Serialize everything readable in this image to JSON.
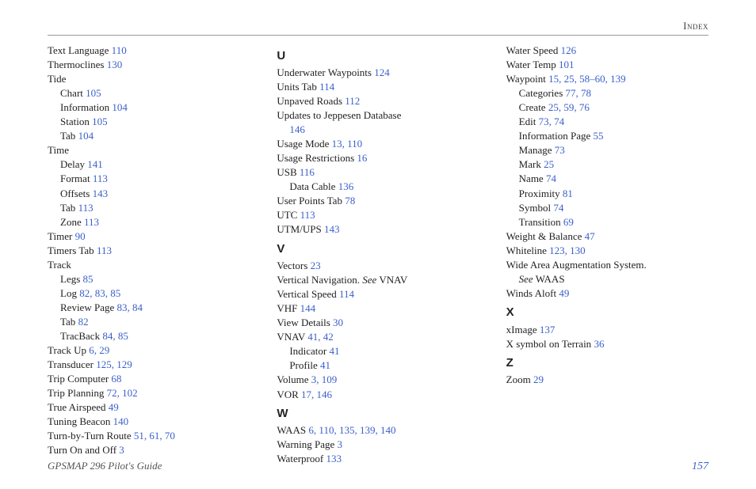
{
  "header": {
    "title": "Index"
  },
  "footer": {
    "guide": "GPSMAP 296 Pilot's Guide",
    "page": "157"
  },
  "columns": [
    {
      "groups": [
        {
          "letter": null,
          "entries": [
            {
              "indent": 0,
              "term": "Text Language",
              "pages": "110"
            },
            {
              "indent": 0,
              "term": "Thermoclines",
              "pages": "130"
            },
            {
              "indent": 0,
              "term": "Tide",
              "pages": ""
            },
            {
              "indent": 1,
              "term": "Chart",
              "pages": "105"
            },
            {
              "indent": 1,
              "term": "Information",
              "pages": "104"
            },
            {
              "indent": 1,
              "term": "Station",
              "pages": "105"
            },
            {
              "indent": 1,
              "term": "Tab",
              "pages": "104"
            },
            {
              "indent": 0,
              "term": "Time",
              "pages": ""
            },
            {
              "indent": 1,
              "term": "Delay",
              "pages": "141"
            },
            {
              "indent": 1,
              "term": "Format",
              "pages": "113"
            },
            {
              "indent": 1,
              "term": "Offsets",
              "pages": "143"
            },
            {
              "indent": 1,
              "term": "Tab",
              "pages": "113"
            },
            {
              "indent": 1,
              "term": "Zone",
              "pages": "113"
            },
            {
              "indent": 0,
              "term": "Timer",
              "pages": "90"
            },
            {
              "indent": 0,
              "term": "Timers Tab",
              "pages": "113"
            },
            {
              "indent": 0,
              "term": "Track",
              "pages": ""
            },
            {
              "indent": 1,
              "term": "Legs",
              "pages": "85"
            },
            {
              "indent": 1,
              "term": "Log",
              "pages": "82, 83, 85"
            },
            {
              "indent": 1,
              "term": "Review Page",
              "pages": "83, 84"
            },
            {
              "indent": 1,
              "term": "Tab",
              "pages": "82"
            },
            {
              "indent": 1,
              "term": "TracBack",
              "pages": "84, 85"
            },
            {
              "indent": 0,
              "term": "Track Up",
              "pages": "6, 29"
            },
            {
              "indent": 0,
              "term": "Transducer",
              "pages": "125, 129"
            },
            {
              "indent": 0,
              "term": "Trip Computer",
              "pages": "68"
            },
            {
              "indent": 0,
              "term": "Trip Planning",
              "pages": "72, 102"
            },
            {
              "indent": 0,
              "term": "True Airspeed",
              "pages": "49"
            },
            {
              "indent": 0,
              "term": "Tuning Beacon",
              "pages": "140"
            },
            {
              "indent": 0,
              "term": "Turn-by-Turn Route",
              "pages": "51, 61, 70"
            },
            {
              "indent": 0,
              "term": "Turn On and Off",
              "pages": "3"
            }
          ]
        }
      ]
    },
    {
      "groups": [
        {
          "letter": "U",
          "entries": [
            {
              "indent": 0,
              "term": "Underwater Waypoints",
              "pages": "124"
            },
            {
              "indent": 0,
              "term": "Units Tab",
              "pages": "114"
            },
            {
              "indent": 0,
              "term": "Unpaved Roads",
              "pages": "112"
            },
            {
              "indent": 0,
              "term": "Updates to Jeppesen Database",
              "pages": ""
            },
            {
              "indent": 1,
              "term": "",
              "pages": "146"
            },
            {
              "indent": 0,
              "term": "Usage Mode",
              "pages": "13, 110"
            },
            {
              "indent": 0,
              "term": "Usage Restrictions",
              "pages": "16"
            },
            {
              "indent": 0,
              "term": "USB",
              "pages": "116"
            },
            {
              "indent": 1,
              "term": "Data Cable",
              "pages": "136"
            },
            {
              "indent": 0,
              "term": "User Points Tab",
              "pages": "78"
            },
            {
              "indent": 0,
              "term": "UTC",
              "pages": "113"
            },
            {
              "indent": 0,
              "term": "UTM/UPS",
              "pages": "143"
            }
          ]
        },
        {
          "letter": "V",
          "entries": [
            {
              "indent": 0,
              "term": "Vectors",
              "pages": "23"
            },
            {
              "indent": 0,
              "term": "Vertical Navigation.",
              "see": "See",
              "seeRef": "VNAV"
            },
            {
              "indent": 0,
              "term": "Vertical Speed",
              "pages": "114"
            },
            {
              "indent": 0,
              "term": "VHF",
              "pages": "144"
            },
            {
              "indent": 0,
              "term": "View Details",
              "pages": "30"
            },
            {
              "indent": 0,
              "term": "VNAV",
              "pages": "41, 42"
            },
            {
              "indent": 1,
              "term": "Indicator",
              "pages": "41"
            },
            {
              "indent": 1,
              "term": "Profile",
              "pages": "41"
            },
            {
              "indent": 0,
              "term": "Volume",
              "pages": "3, 109"
            },
            {
              "indent": 0,
              "term": "VOR",
              "pages": "17, 146"
            }
          ]
        },
        {
          "letter": "W",
          "entries": [
            {
              "indent": 0,
              "term": "WAAS",
              "pages": "6, 110, 135, 139, 140"
            },
            {
              "indent": 0,
              "term": "Warning Page",
              "pages": "3"
            },
            {
              "indent": 0,
              "term": "Waterproof",
              "pages": "133"
            }
          ]
        }
      ]
    },
    {
      "groups": [
        {
          "letter": null,
          "entries": [
            {
              "indent": 0,
              "term": "Water Speed",
              "pages": "126"
            },
            {
              "indent": 0,
              "term": "Water Temp",
              "pages": "101"
            },
            {
              "indent": 0,
              "term": "Waypoint",
              "pages": "15, 25, 58–60, 139"
            },
            {
              "indent": 1,
              "term": "Categories",
              "pages": "77, 78"
            },
            {
              "indent": 1,
              "term": "Create",
              "pages": "25, 59, 76"
            },
            {
              "indent": 1,
              "term": "Edit",
              "pages": "73, 74"
            },
            {
              "indent": 1,
              "term": "Information Page",
              "pages": "55"
            },
            {
              "indent": 1,
              "term": "Manage",
              "pages": "73"
            },
            {
              "indent": 1,
              "term": "Mark",
              "pages": "25"
            },
            {
              "indent": 1,
              "term": "Name",
              "pages": "74"
            },
            {
              "indent": 1,
              "term": "Proximity",
              "pages": "81"
            },
            {
              "indent": 1,
              "term": "Symbol",
              "pages": "74"
            },
            {
              "indent": 1,
              "term": "Transition",
              "pages": "69"
            },
            {
              "indent": 0,
              "term": "Weight & Balance",
              "pages": "47"
            },
            {
              "indent": 0,
              "term": "Whiteline",
              "pages": "123, 130"
            },
            {
              "indent": 0,
              "term": "Wide Area Augmentation System.",
              "pages": ""
            },
            {
              "indent": 1,
              "see": "See",
              "seeRef": "WAAS"
            },
            {
              "indent": 0,
              "term": "Winds Aloft",
              "pages": "49"
            }
          ]
        },
        {
          "letter": "X",
          "entries": [
            {
              "indent": 0,
              "term": "xImage",
              "pages": "137"
            },
            {
              "indent": 0,
              "term": "X symbol on Terrain",
              "pages": "36"
            }
          ]
        },
        {
          "letter": "Z",
          "entries": [
            {
              "indent": 0,
              "term": "Zoom",
              "pages": "29"
            }
          ]
        }
      ]
    }
  ]
}
